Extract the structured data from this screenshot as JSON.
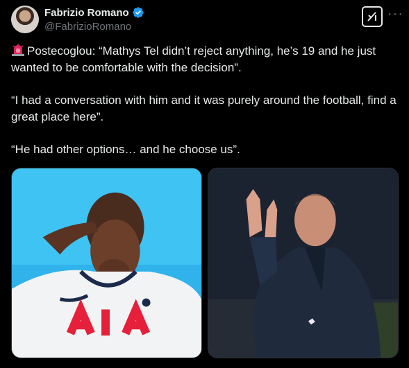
{
  "author": {
    "display_name": "Fabrizio Romano",
    "handle": "@FabrizioRomano",
    "verified": true,
    "avatar_icon": "author-avatar"
  },
  "actions": {
    "grok_icon": "grok-icon",
    "more_icon": "more-options-icon"
  },
  "tweet": {
    "emoji_icon": "rotating-light-icon",
    "paragraphs": [
      "Postecoglou: “Mathys Tel didn’t reject anything, he’s 19 and he just wanted to be comfortable with the decision”.",
      "“I had a conversation with him and it was purely around the football, find a great place here”.",
      "“He had other options… and he choose us”."
    ]
  },
  "media": {
    "photo_1": "player-photo",
    "photo_2": "coach-photo"
  },
  "colors": {
    "background": "#000000",
    "text": "#e7e9ea",
    "muted": "#71767b",
    "verified": "#1d9bf0"
  }
}
